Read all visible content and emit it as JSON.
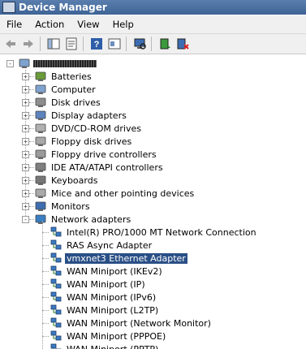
{
  "window": {
    "title": "Device Manager"
  },
  "menu": {
    "file": "File",
    "action": "Action",
    "view": "View",
    "help": "Help"
  },
  "toolbar": {
    "icons": [
      "back-arrow-icon",
      "forward-arrow-icon",
      "show-hide-tree-icon",
      "properties-icon",
      "help-icon",
      "view-icon",
      "scan-hardware-icon",
      "update-driver-icon",
      "uninstall-icon"
    ]
  },
  "tree": {
    "categories": [
      "Batteries",
      "Computer",
      "Disk drives",
      "Display adapters",
      "DVD/CD-ROM drives",
      "Floppy disk drives",
      "Floppy drive controllers",
      "IDE ATA/ATAPI controllers",
      "Keyboards",
      "Mice and other pointing devices",
      "Monitors",
      "Network adapters"
    ],
    "network_adapters": [
      "Intel(R) PRO/1000 MT Network Connection",
      "RAS Async Adapter",
      "vmxnet3 Ethernet Adapter",
      "WAN Miniport (IKEv2)",
      "WAN Miniport (IP)",
      "WAN Miniport (IPv6)",
      "WAN Miniport (L2TP)",
      "WAN Miniport (Network Monitor)",
      "WAN Miniport (PPPOE)",
      "WAN Miniport (PPTP)"
    ],
    "selected": "vmxnet3 Ethernet Adapter",
    "expand_collapsed": "+",
    "expand_open": "-"
  },
  "colors": {
    "selection": "#2a4f86",
    "titlebar": "#4a6fa0"
  }
}
